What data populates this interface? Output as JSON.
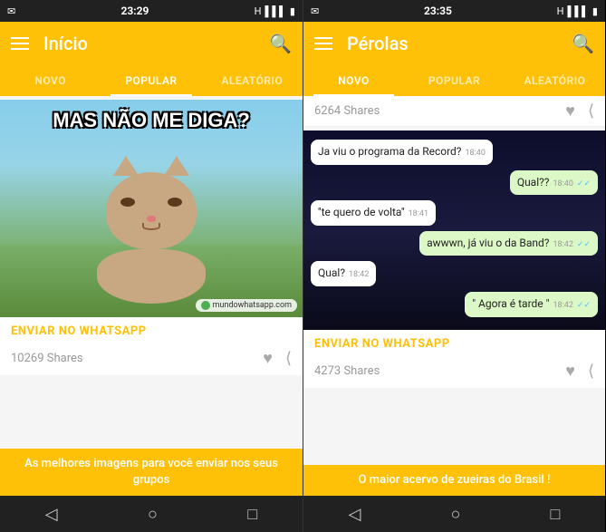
{
  "left_panel": {
    "status_bar": {
      "left_icons": "≡ ▾",
      "time": "23:29",
      "right_icons": "H ▌▌▌ 🔋"
    },
    "toolbar": {
      "menu_label": "menu",
      "title": "Início",
      "search_label": "search"
    },
    "tabs": [
      {
        "label": "NOVO",
        "active": false
      },
      {
        "label": "POPULAR",
        "active": true
      },
      {
        "label": "ALEATÓRIO",
        "active": false
      }
    ],
    "card": {
      "meme_text": "MAS NÃO ME DIGA?",
      "watermark": "mundowhatsapp.com",
      "enviar_label": "ENVIAR NO WHATSAPP",
      "shares": "10269 Shares"
    },
    "banner": {
      "text": "As melhores imagens para você\nenviar nos seus grupos"
    },
    "nav": {
      "back": "◁",
      "home": "○",
      "recent": "□"
    }
  },
  "right_panel": {
    "status_bar": {
      "time": "23:35"
    },
    "toolbar": {
      "title": "Pérolas",
      "search_label": "search"
    },
    "tabs": [
      {
        "label": "NOVO",
        "active": true
      },
      {
        "label": "POPULAR",
        "active": false
      },
      {
        "label": "ALEATÓRIO",
        "active": false
      }
    ],
    "card1": {
      "shares": "6264 Shares",
      "chat_messages": [
        {
          "text": "Ja viu o programa da Record?",
          "time": "18:40",
          "type": "received"
        },
        {
          "text": "Qual??",
          "time": "18:40",
          "type": "sent"
        },
        {
          "text": "''te quero de volta''",
          "time": "18:41",
          "type": "received"
        },
        {
          "text": "awwwn, já viu o da Band?",
          "time": "18:42",
          "type": "sent"
        },
        {
          "text": "Qual?",
          "time": "18:42",
          "type": "received"
        },
        {
          "text": "\" Agora é tarde \"",
          "time": "18:42",
          "type": "sent"
        }
      ],
      "enviar_label": "ENVIAR NO WHATSAPP"
    },
    "card2": {
      "shares": "4273 Shares"
    },
    "banner": {
      "text": "O maior acervo de zueiras do Brasil !"
    },
    "nav": {
      "back": "◁",
      "home": "○",
      "recent": "□"
    }
  }
}
